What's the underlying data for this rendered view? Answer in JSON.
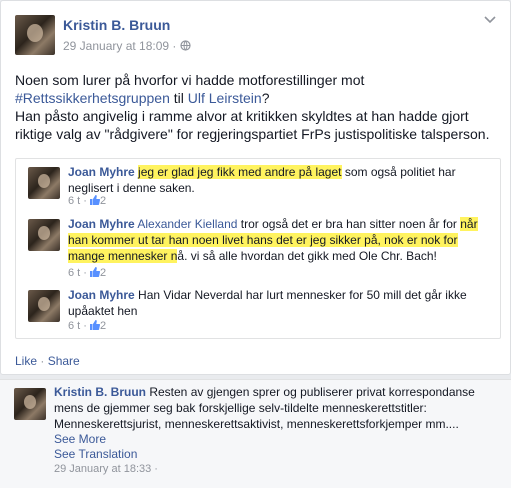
{
  "post": {
    "author": "Kristin B. Bruun",
    "timestamp": "29 January at 18:09",
    "separator": "·",
    "chevron_icon": "chevron-down-icon",
    "privacy_icon": "globe-icon",
    "line1": "Noen som lurer på hvorfor vi hadde motforestillinger mot",
    "hashtag": "#Rettssikkerhetsgruppen",
    "til": " til ",
    "mention": "Ulf Leirstein",
    "qmark": "?",
    "line3": "Han påsto angivelig i ramme alvor at kritikken skyldtes at han hadde gjort riktige valg av \"rådgivere\" for regjeringspartiet FrPs justispolitiske talsperson."
  },
  "comments": [
    {
      "name": "Joan Myhre",
      "highlight": "jeg er glad jeg fikk med andre på laget",
      "rest": " som også politiet har neglisert i denne saken.",
      "meta": "6 t ·",
      "likes": "2"
    },
    {
      "name": "Joan Myhre",
      "mention": "Alexander Kielland",
      "text_before": " tror også det er bra han sitter noen år for ",
      "highlight": "når han kommer ut tar han noen livet hans det er jeg sikker på, nok er nok for mange mennesker n",
      "rest": "å. vi så alle hvordan det gikk med Ole Chr. Bach!",
      "meta": "6 t ·",
      "likes": "2"
    },
    {
      "name": "Joan Myhre",
      "text": " Han Vidar Neverdal har lurt mennesker for 50 mill det går ikke upåaktet hen",
      "meta": "6 t ·",
      "likes": "2"
    }
  ],
  "actions": {
    "like": "Like",
    "separator": " · ",
    "share": "Share"
  },
  "reply": {
    "name": "Kristin B. Bruun",
    "text": " Resten av gjengen sprer og publiserer privat korrespondanse mens de gjemmer seg bak forskjellige selv-tildelte menneskerettstitler: Menneskerettsjurist, menneskerettsaktivist, menneskerettsforkjemper mm....",
    "see_more": "See More",
    "see_translation": "See Translation",
    "timestamp": "29 January at 18:33 ·"
  },
  "colors": {
    "link": "#3b5998",
    "highlight": "#fff35f",
    "meta": "#90949c"
  }
}
